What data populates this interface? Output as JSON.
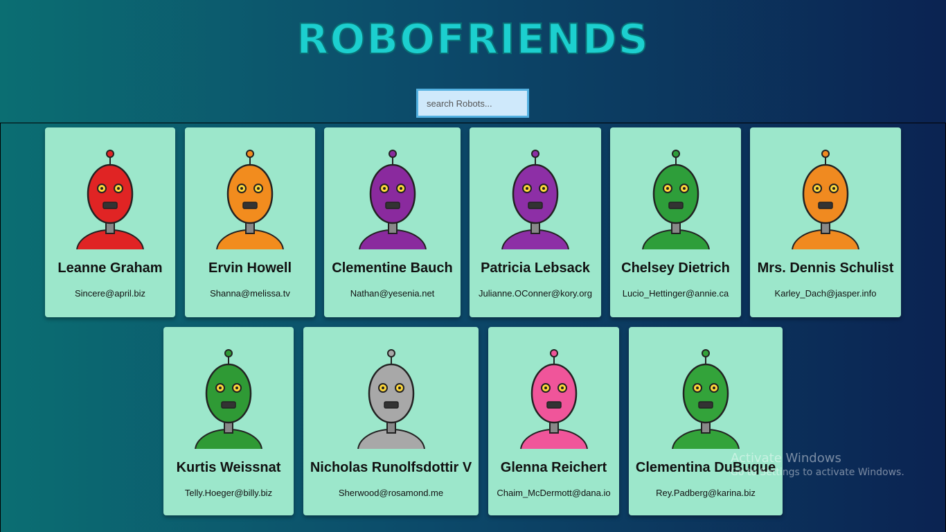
{
  "header": {
    "title": "ROBOFRIENDS"
  },
  "search": {
    "placeholder": "search Robots..."
  },
  "robots": [
    {
      "name": "Leanne Graham",
      "email": "Sincere@april.biz",
      "color": "#e02424"
    },
    {
      "name": "Ervin Howell",
      "email": "Shanna@melissa.tv",
      "color": "#f28c1e"
    },
    {
      "name": "Clementine Bauch",
      "email": "Nathan@yesenia.net",
      "color": "#8a2a9e"
    },
    {
      "name": "Patricia Lebsack",
      "email": "Julianne.OConner@kory.org",
      "color": "#8d2fa6"
    },
    {
      "name": "Chelsey Dietrich",
      "email": "Lucio_Hettinger@annie.ca",
      "color": "#2e9e3a"
    },
    {
      "name": "Mrs. Dennis Schulist",
      "email": "Karley_Dach@jasper.info",
      "color": "#f08a20"
    },
    {
      "name": "Kurtis Weissnat",
      "email": "Telly.Hoeger@billy.biz",
      "color": "#2f9a35"
    },
    {
      "name": "Nicholas Runolfsdottir V",
      "email": "Sherwood@rosamond.me",
      "color": "#a8a8a8"
    },
    {
      "name": "Glenna Reichert",
      "email": "Chaim_McDermott@dana.io",
      "color": "#f0559a"
    },
    {
      "name": "Clementina DuBuque",
      "email": "Rey.Padberg@karina.biz",
      "color": "#33a33a"
    }
  ],
  "watermark": {
    "line1": "Activate Windows",
    "line2": "Go to Settings to activate Windows."
  }
}
